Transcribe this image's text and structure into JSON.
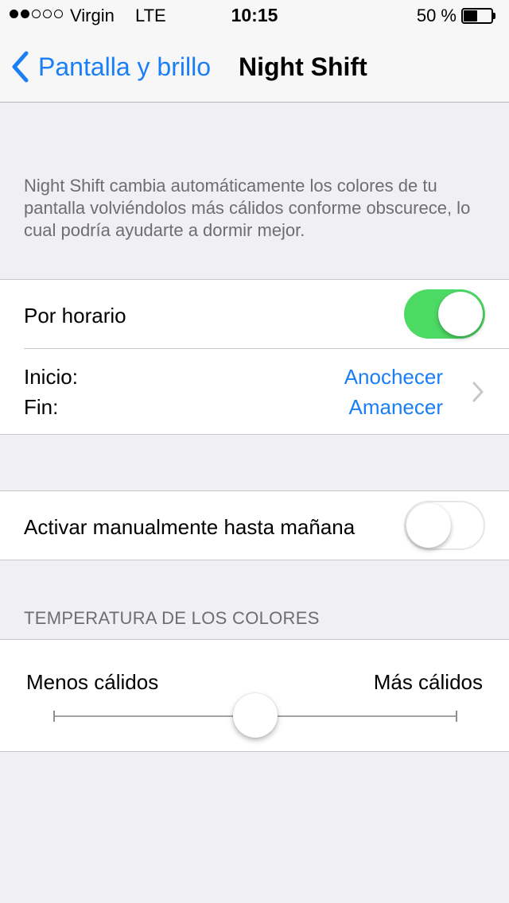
{
  "status_bar": {
    "signal_strength": 2,
    "signal_max": 5,
    "carrier": "Virgin",
    "network": "LTE",
    "time": "10:15",
    "battery_percent_label": "50 %",
    "battery_level": 0.5
  },
  "nav": {
    "back_label": "Pantalla y brillo",
    "title": "Night Shift",
    "back_icon": "chevron-left-icon"
  },
  "description": "Night Shift cambia automáticamente los colores de tu pantalla volviéndolos más cálidos conforme obscurece, lo cual podría ayudarte a dormir mejor.",
  "schedule": {
    "label": "Por horario",
    "enabled": true,
    "start_label": "Inicio:",
    "start_value": "Anochecer",
    "end_label": "Fin:",
    "end_value": "Amanecer",
    "disclosure_icon": "chevron-right-icon"
  },
  "manual": {
    "label": "Activar manualmente hasta mañana",
    "enabled": false
  },
  "temperature": {
    "header": "TEMPERATURA DE LOS COLORES",
    "min_label": "Menos cálidos",
    "max_label": "Más cálidos",
    "value": 0.5
  },
  "colors": {
    "accent": "#1a7ef5",
    "switch_on": "#4cd964",
    "background": "#efeff4"
  }
}
